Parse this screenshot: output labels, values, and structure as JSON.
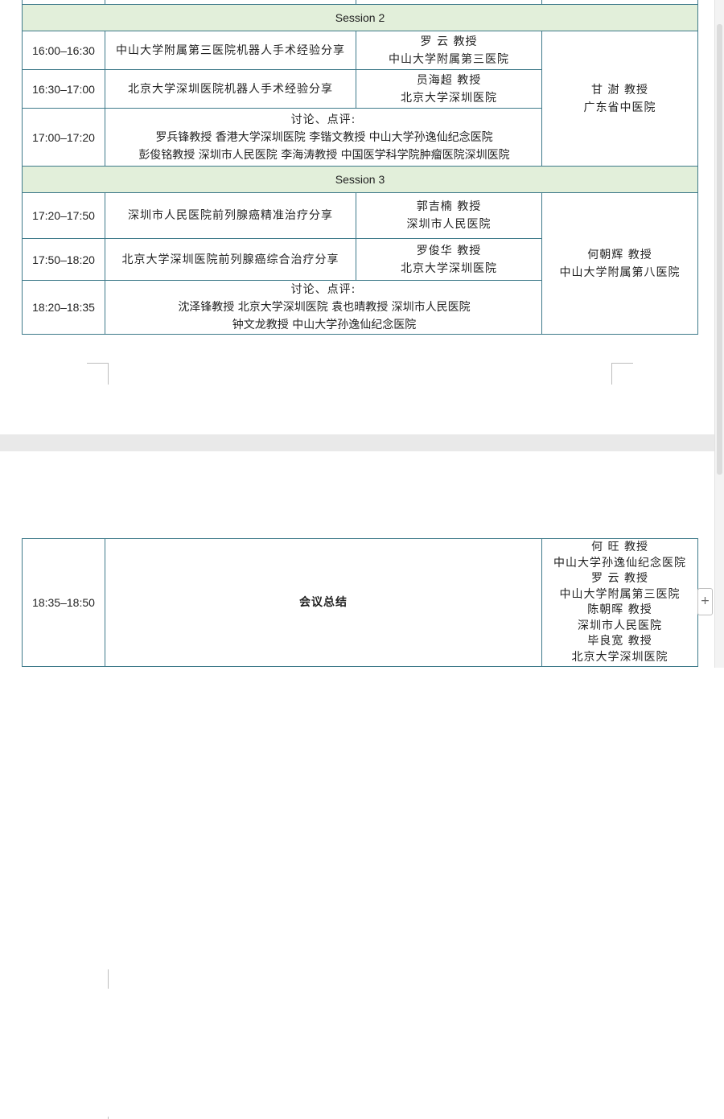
{
  "document": {
    "sessions": [
      {
        "header": "Session 2",
        "rows": [
          {
            "time": "16:00–16:30",
            "title": "中山大学附属第三医院机器人手术经验分享",
            "speaker_name": "罗 云 教授",
            "speaker_org": "中山大学附属第三医院"
          },
          {
            "time": "16:30–17:00",
            "title": "北京大学深圳医院机器人手术经验分享",
            "speaker_name": "员海超 教授",
            "speaker_org": "北京大学深圳医院"
          }
        ],
        "moderator_name": "甘 澍 教授",
        "moderator_org": "广东省中医院",
        "discussion": {
          "time": "17:00–17:20",
          "label": "讨论、点评:",
          "lines": [
            "罗兵锋教授 香港大学深圳医院    李锴文教授 中山大学孙逸仙纪念医院",
            "彭俊铭教授 深圳市人民医院   李海涛教授 中国医学科学院肿瘤医院深圳医院"
          ]
        }
      },
      {
        "header": "Session 3",
        "rows": [
          {
            "time": "17:20–17:50",
            "title": "深圳市人民医院前列腺癌精准治疗分享",
            "speaker_name": "郭吉楠 教授",
            "speaker_org": "深圳市人民医院"
          },
          {
            "time": "17:50–18:20",
            "title": "北京大学深圳医院前列腺癌综合治疗分享",
            "speaker_name": "罗俊华 教授",
            "speaker_org": "北京大学深圳医院"
          }
        ],
        "moderator_name": "何朝辉 教授",
        "moderator_org": "中山大学附属第八医院",
        "discussion": {
          "time": "18:20–18:35",
          "label": "讨论、点评:",
          "lines": [
            "沈泽锋教授 北京大学深圳医院   袁也晴教授 深圳市人民医院",
            "钟文龙教授 中山大学孙逸仙纪念医院"
          ]
        }
      }
    ],
    "summary": {
      "time": "18:35–18:50",
      "title": "会议总结",
      "presenters": [
        "何 旺 教授",
        "中山大学孙逸仙纪念医院",
        "罗 云  教授",
        "中山大学附属第三医院",
        "陈朝晖 教授",
        "深圳市人民医院",
        "毕良宽 教授",
        "北京大学深圳医院"
      ]
    }
  },
  "ui": {
    "add_button_label": "+",
    "colors": {
      "session_header_bg": "#e2efda",
      "table_border": "#3e7a8a",
      "page_gap": "#e9e9e9"
    }
  }
}
